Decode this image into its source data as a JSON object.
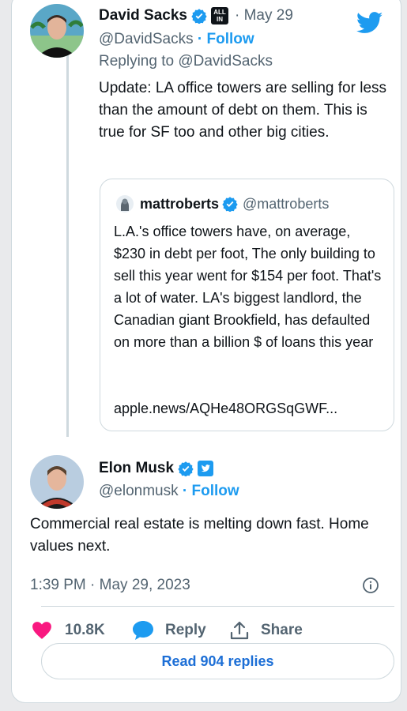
{
  "tweet1": {
    "name": "David Sacks",
    "badge_text": "ALL IN",
    "date": "· May 29",
    "handle": "@DavidSacks",
    "follow": "· Follow",
    "replying_to": "Replying to @DavidSacks",
    "text": "Update: LA office towers are selling for less than the amount of debt on them. This is true for SF too and other big cities."
  },
  "quote": {
    "name": "mattroberts",
    "handle": "@mattroberts",
    "text": "L.A.'s office towers have, on average, $230 in debt per foot, The only building to sell this year went for $154 per foot. That's a lot of water. LA's biggest landlord, the Canadian giant Brookfield, has defaulted on more than a billion $ of loans this year",
    "link": "apple.news/AQHe48ORGSqGWF..."
  },
  "tweet2": {
    "name": "Elon Musk",
    "handle": "@elonmusk",
    "follow": "· Follow",
    "text": "Commercial real estate is melting down fast. Home values next.",
    "timestamp": "1:39 PM · May 29, 2023"
  },
  "actions": {
    "likes": "10.8K",
    "reply": "Reply",
    "share": "Share"
  },
  "read_replies": "Read 904 replies",
  "colors": {
    "verified": "#1d9bf0",
    "like": "#f91880",
    "link": "#1d9bf0"
  },
  "icons": {
    "twitter": "twitter-bird-icon",
    "verified": "verified-badge-icon",
    "like": "heart-icon",
    "reply": "speech-bubble-icon",
    "share": "share-icon",
    "info": "info-icon"
  }
}
